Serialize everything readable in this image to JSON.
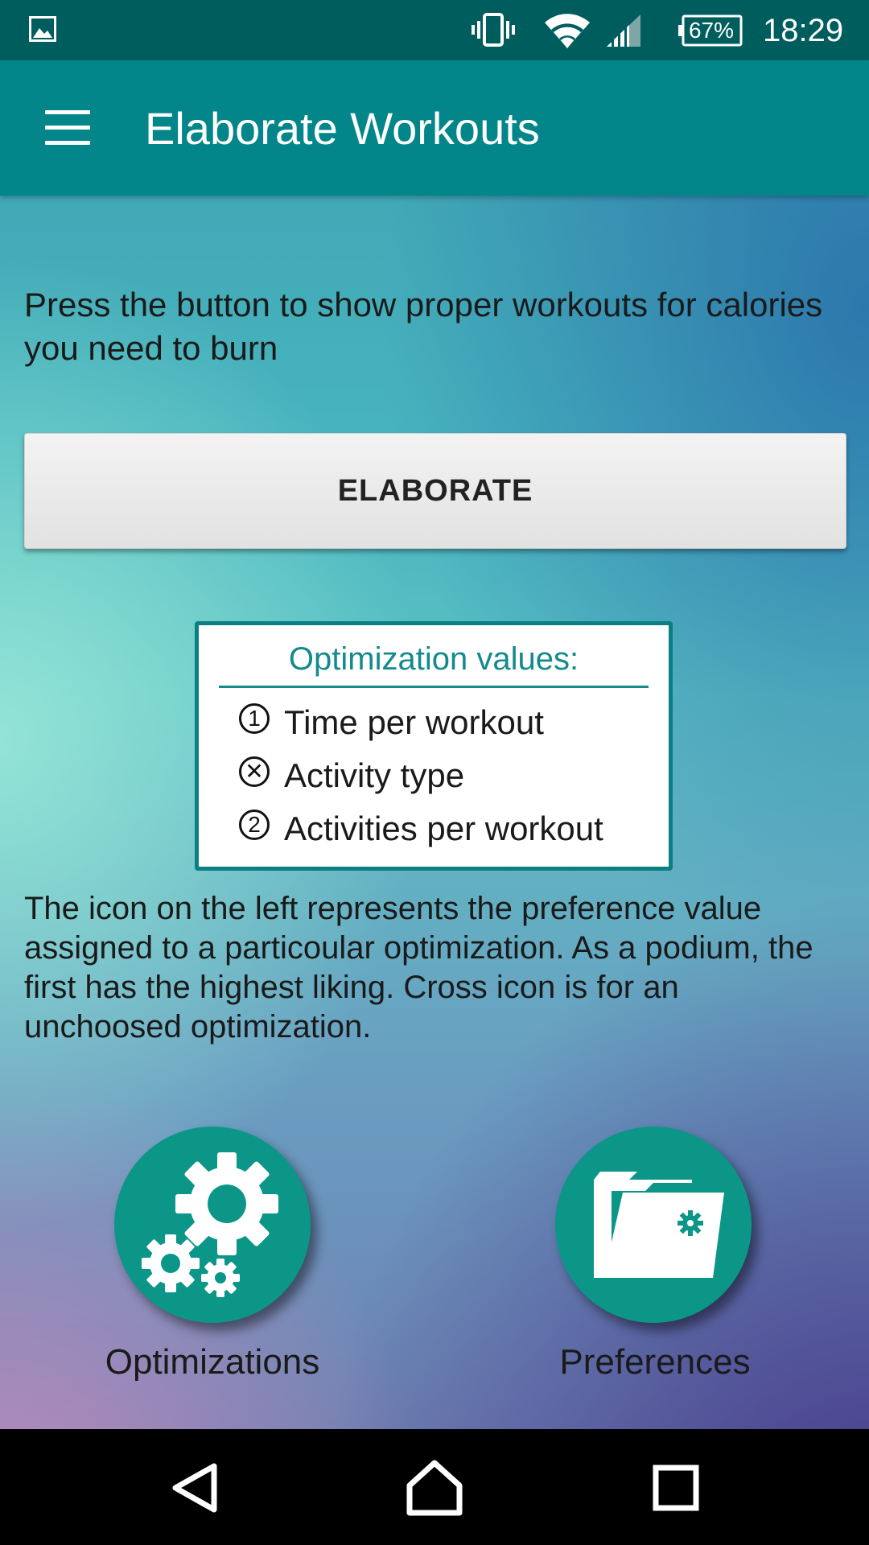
{
  "status_bar": {
    "battery": "67%",
    "time": "18:29",
    "icons": [
      "image-icon",
      "vibrate-icon",
      "wifi-icon",
      "signal-icon",
      "battery-icon"
    ]
  },
  "app_bar": {
    "title": "Elaborate Workouts",
    "menu_icon": "hamburger-menu-icon"
  },
  "main": {
    "intro": "Press the button to show proper workouts for calories you need to burn",
    "elaborate_button": "ELABORATE",
    "optimization_box": {
      "title": "Optimization values:",
      "items": [
        {
          "badge": "1",
          "label": "Time per workout"
        },
        {
          "badge": "✕",
          "label": "Activity type"
        },
        {
          "badge": "2",
          "label": "Activities per workout"
        }
      ]
    },
    "explanation": "The icon on the left represents the preference value assigned to a particoular optimization. As a podium, the first has the highest liking. Cross icon is for an unchoosed optimization.",
    "actions": [
      {
        "label": "Optimizations",
        "icon": "gears-icon"
      },
      {
        "label": "Preferences",
        "icon": "folder-settings-icon"
      }
    ]
  },
  "nav_bar": {
    "buttons": [
      "back-icon",
      "home-icon",
      "recents-icon"
    ]
  },
  "colors": {
    "status_bar": "#005d5e",
    "app_bar": "#02868a",
    "accent": "#0c9688",
    "box_border": "#0b7f82"
  }
}
